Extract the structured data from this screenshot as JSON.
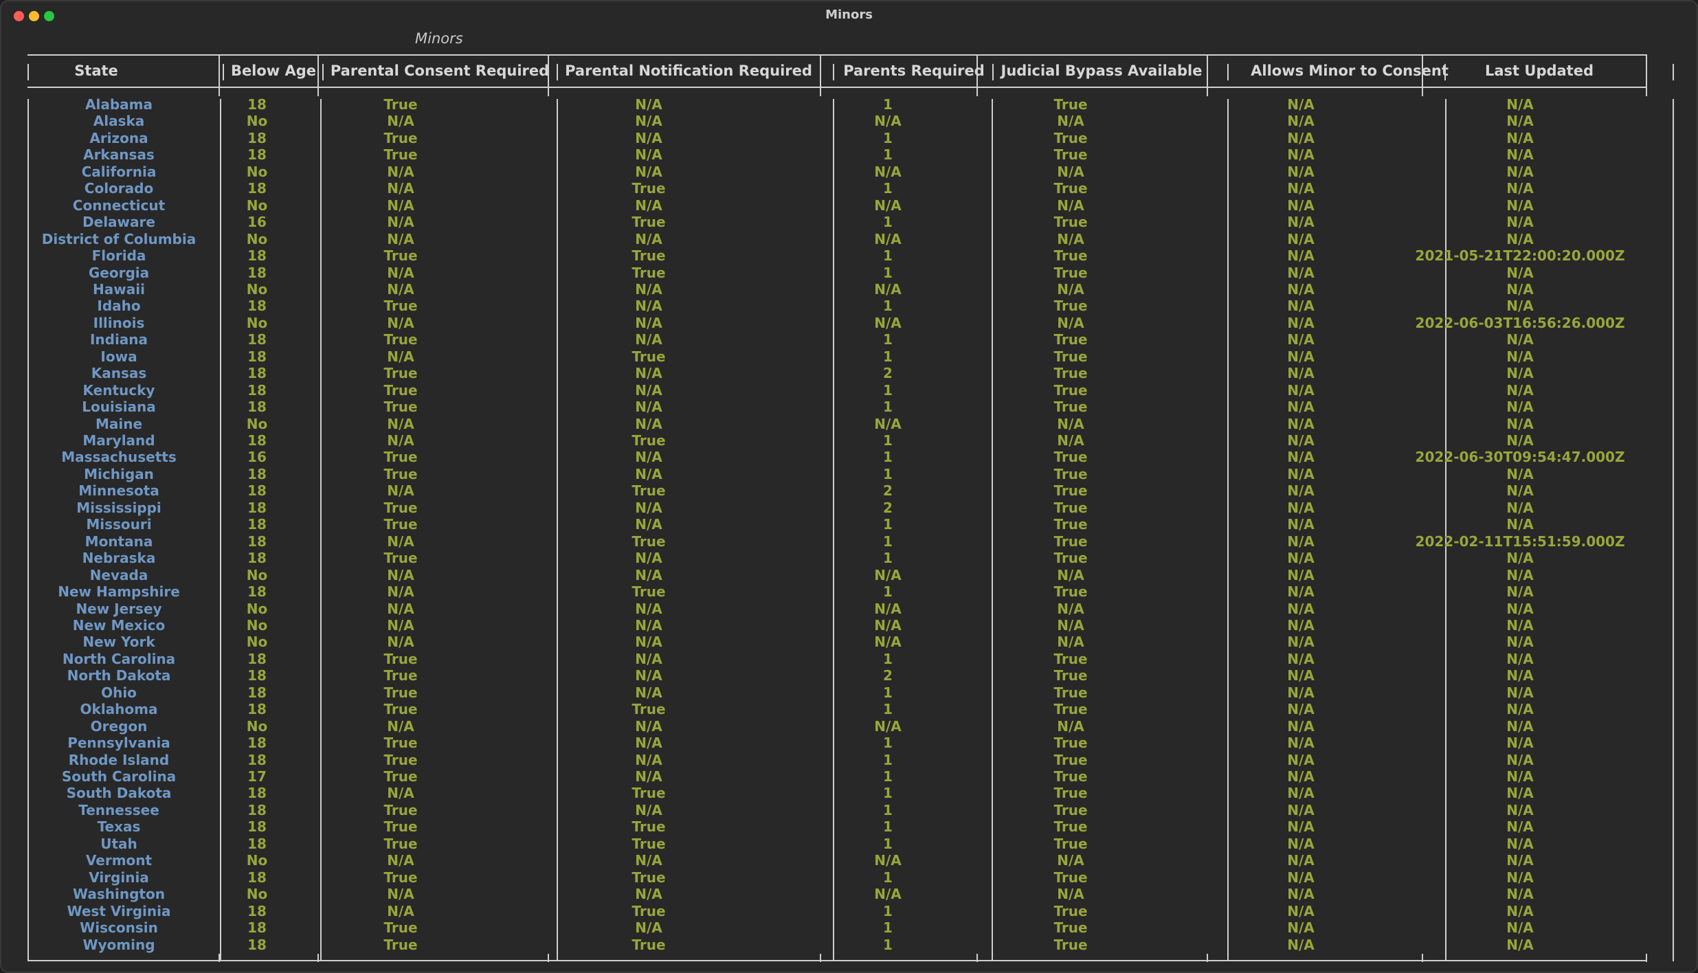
{
  "window": {
    "title": "Minors"
  },
  "table": {
    "caption": "Minors",
    "columns": [
      "State",
      "Below Age",
      "Parental Consent Required",
      "Parental Notification Required",
      "Parents Required",
      "Judicial Bypass Available",
      "Allows Minor to Consent",
      "Last Updated"
    ],
    "rows": [
      [
        "Alabama",
        "18",
        "True",
        "N/A",
        "1",
        "True",
        "N/A",
        "N/A"
      ],
      [
        "Alaska",
        "No",
        "N/A",
        "N/A",
        "N/A",
        "N/A",
        "N/A",
        "N/A"
      ],
      [
        "Arizona",
        "18",
        "True",
        "N/A",
        "1",
        "True",
        "N/A",
        "N/A"
      ],
      [
        "Arkansas",
        "18",
        "True",
        "N/A",
        "1",
        "True",
        "N/A",
        "N/A"
      ],
      [
        "California",
        "No",
        "N/A",
        "N/A",
        "N/A",
        "N/A",
        "N/A",
        "N/A"
      ],
      [
        "Colorado",
        "18",
        "N/A",
        "True",
        "1",
        "True",
        "N/A",
        "N/A"
      ],
      [
        "Connecticut",
        "No",
        "N/A",
        "N/A",
        "N/A",
        "N/A",
        "N/A",
        "N/A"
      ],
      [
        "Delaware",
        "16",
        "N/A",
        "True",
        "1",
        "True",
        "N/A",
        "N/A"
      ],
      [
        "District of Columbia",
        "No",
        "N/A",
        "N/A",
        "N/A",
        "N/A",
        "N/A",
        "N/A"
      ],
      [
        "Florida",
        "18",
        "True",
        "True",
        "1",
        "True",
        "N/A",
        "2021-05-21T22:00:20.000Z"
      ],
      [
        "Georgia",
        "18",
        "N/A",
        "True",
        "1",
        "True",
        "N/A",
        "N/A"
      ],
      [
        "Hawaii",
        "No",
        "N/A",
        "N/A",
        "N/A",
        "N/A",
        "N/A",
        "N/A"
      ],
      [
        "Idaho",
        "18",
        "True",
        "N/A",
        "1",
        "True",
        "N/A",
        "N/A"
      ],
      [
        "Illinois",
        "No",
        "N/A",
        "N/A",
        "N/A",
        "N/A",
        "N/A",
        "2022-06-03T16:56:26.000Z"
      ],
      [
        "Indiana",
        "18",
        "True",
        "N/A",
        "1",
        "True",
        "N/A",
        "N/A"
      ],
      [
        "Iowa",
        "18",
        "N/A",
        "True",
        "1",
        "True",
        "N/A",
        "N/A"
      ],
      [
        "Kansas",
        "18",
        "True",
        "N/A",
        "2",
        "True",
        "N/A",
        "N/A"
      ],
      [
        "Kentucky",
        "18",
        "True",
        "N/A",
        "1",
        "True",
        "N/A",
        "N/A"
      ],
      [
        "Louisiana",
        "18",
        "True",
        "N/A",
        "1",
        "True",
        "N/A",
        "N/A"
      ],
      [
        "Maine",
        "No",
        "N/A",
        "N/A",
        "N/A",
        "N/A",
        "N/A",
        "N/A"
      ],
      [
        "Maryland",
        "18",
        "N/A",
        "True",
        "1",
        "N/A",
        "N/A",
        "N/A"
      ],
      [
        "Massachusetts",
        "16",
        "True",
        "N/A",
        "1",
        "True",
        "N/A",
        "2022-06-30T09:54:47.000Z"
      ],
      [
        "Michigan",
        "18",
        "True",
        "N/A",
        "1",
        "True",
        "N/A",
        "N/A"
      ],
      [
        "Minnesota",
        "18",
        "N/A",
        "True",
        "2",
        "True",
        "N/A",
        "N/A"
      ],
      [
        "Mississippi",
        "18",
        "True",
        "N/A",
        "2",
        "True",
        "N/A",
        "N/A"
      ],
      [
        "Missouri",
        "18",
        "True",
        "N/A",
        "1",
        "True",
        "N/A",
        "N/A"
      ],
      [
        "Montana",
        "18",
        "N/A",
        "True",
        "1",
        "True",
        "N/A",
        "2022-02-11T15:51:59.000Z"
      ],
      [
        "Nebraska",
        "18",
        "True",
        "N/A",
        "1",
        "True",
        "N/A",
        "N/A"
      ],
      [
        "Nevada",
        "No",
        "N/A",
        "N/A",
        "N/A",
        "N/A",
        "N/A",
        "N/A"
      ],
      [
        "New Hampshire",
        "18",
        "N/A",
        "True",
        "1",
        "True",
        "N/A",
        "N/A"
      ],
      [
        "New Jersey",
        "No",
        "N/A",
        "N/A",
        "N/A",
        "N/A",
        "N/A",
        "N/A"
      ],
      [
        "New Mexico",
        "No",
        "N/A",
        "N/A",
        "N/A",
        "N/A",
        "N/A",
        "N/A"
      ],
      [
        "New York",
        "No",
        "N/A",
        "N/A",
        "N/A",
        "N/A",
        "N/A",
        "N/A"
      ],
      [
        "North Carolina",
        "18",
        "True",
        "N/A",
        "1",
        "True",
        "N/A",
        "N/A"
      ],
      [
        "North Dakota",
        "18",
        "True",
        "N/A",
        "2",
        "True",
        "N/A",
        "N/A"
      ],
      [
        "Ohio",
        "18",
        "True",
        "N/A",
        "1",
        "True",
        "N/A",
        "N/A"
      ],
      [
        "Oklahoma",
        "18",
        "True",
        "True",
        "1",
        "True",
        "N/A",
        "N/A"
      ],
      [
        "Oregon",
        "No",
        "N/A",
        "N/A",
        "N/A",
        "N/A",
        "N/A",
        "N/A"
      ],
      [
        "Pennsylvania",
        "18",
        "True",
        "N/A",
        "1",
        "True",
        "N/A",
        "N/A"
      ],
      [
        "Rhode Island",
        "18",
        "True",
        "N/A",
        "1",
        "True",
        "N/A",
        "N/A"
      ],
      [
        "South Carolina",
        "17",
        "True",
        "N/A",
        "1",
        "True",
        "N/A",
        "N/A"
      ],
      [
        "South Dakota",
        "18",
        "N/A",
        "True",
        "1",
        "True",
        "N/A",
        "N/A"
      ],
      [
        "Tennessee",
        "18",
        "True",
        "N/A",
        "1",
        "True",
        "N/A",
        "N/A"
      ],
      [
        "Texas",
        "18",
        "True",
        "True",
        "1",
        "True",
        "N/A",
        "N/A"
      ],
      [
        "Utah",
        "18",
        "True",
        "True",
        "1",
        "True",
        "N/A",
        "N/A"
      ],
      [
        "Vermont",
        "No",
        "N/A",
        "N/A",
        "N/A",
        "N/A",
        "N/A",
        "N/A"
      ],
      [
        "Virginia",
        "18",
        "True",
        "True",
        "1",
        "True",
        "N/A",
        "N/A"
      ],
      [
        "Washington",
        "No",
        "N/A",
        "N/A",
        "N/A",
        "N/A",
        "N/A",
        "N/A"
      ],
      [
        "West Virginia",
        "18",
        "N/A",
        "True",
        "1",
        "True",
        "N/A",
        "N/A"
      ],
      [
        "Wisconsin",
        "18",
        "True",
        "N/A",
        "1",
        "True",
        "N/A",
        "N/A"
      ],
      [
        "Wyoming",
        "18",
        "True",
        "True",
        "1",
        "True",
        "N/A",
        "N/A"
      ]
    ]
  },
  "colors": {
    "state": "#6f97c4",
    "value": "#98a63b",
    "header": "#d7d7d7",
    "background": "#282828"
  }
}
